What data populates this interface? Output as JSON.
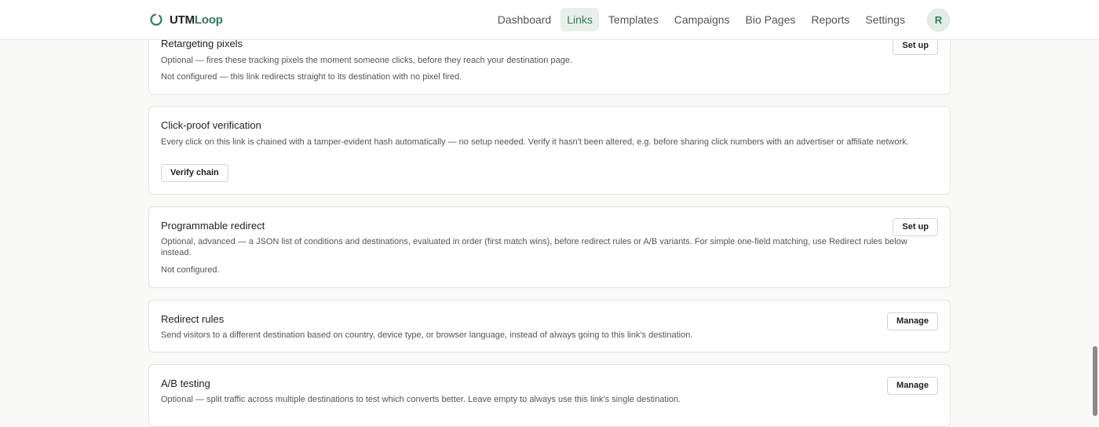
{
  "brand": {
    "name_part1": "UTM",
    "name_part2": "Loop",
    "icon": "ring-logo-icon"
  },
  "nav": {
    "items": [
      "Dashboard",
      "Links",
      "Templates",
      "Campaigns",
      "Bio Pages",
      "Reports",
      "Settings"
    ],
    "active": "Links",
    "avatar_initial": "R"
  },
  "cards": {
    "retargeting": {
      "title": "Retargeting pixels",
      "desc": "Optional — fires these tracking pixels the moment someone clicks, before they reach your destination page.",
      "status": "Not configured — this link redirects straight to its destination with no pixel fired.",
      "button": "Set up"
    },
    "clickproof": {
      "title": "Click-proof verification",
      "desc": "Every click on this link is chained with a tamper-evident hash automatically — no setup needed. Verify it hasn't been altered, e.g. before sharing click numbers with an advertiser or affiliate network.",
      "button": "Verify chain"
    },
    "programmable": {
      "title": "Programmable redirect",
      "desc": "Optional, advanced — a JSON list of conditions and destinations, evaluated in order (first match wins), before redirect rules or A/B variants. For simple one-field matching, use Redirect rules below instead.",
      "status": "Not configured.",
      "button": "Set up"
    },
    "redirect_rules": {
      "title": "Redirect rules",
      "desc": "Send visitors to a different destination based on country, device type, or browser language, instead of always going to this link's destination.",
      "button": "Manage"
    },
    "ab_testing": {
      "title": "A/B testing",
      "desc": "Optional — split traffic across multiple destinations to test which converts better. Leave empty to always use this link's single destination.",
      "button": "Manage"
    }
  },
  "colors": {
    "accent": "#2e7d5b",
    "nav_active_bg": "#e8efea",
    "page_bg": "#f9f9f8"
  }
}
